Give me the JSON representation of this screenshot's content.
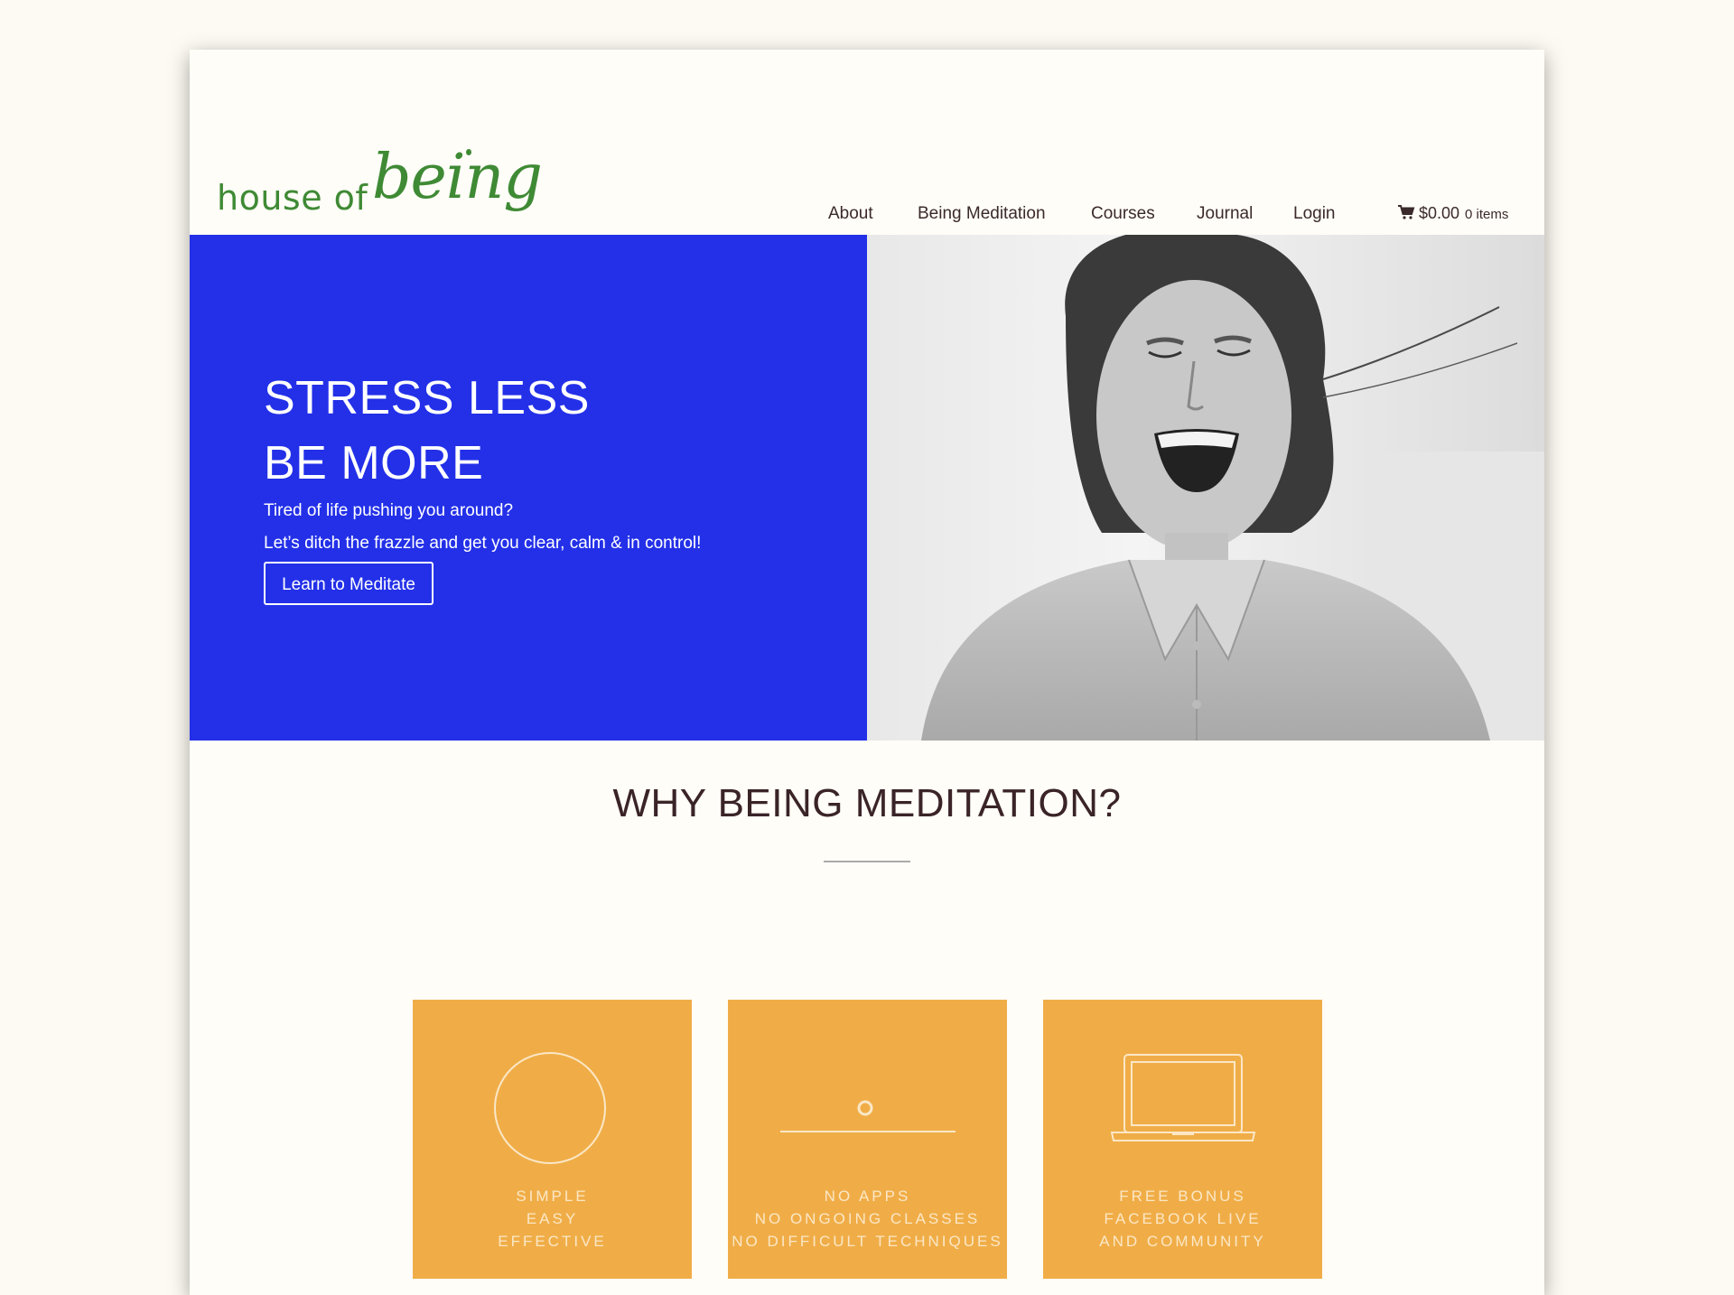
{
  "brand": {
    "name_part1": "house of",
    "name_part2": "being",
    "color": "#3f8a35"
  },
  "nav": {
    "items": [
      {
        "label": "About"
      },
      {
        "label": "Being Meditation"
      },
      {
        "label": "Courses"
      },
      {
        "label": "Journal"
      },
      {
        "label": "Login"
      }
    ],
    "cart": {
      "icon": "cart-icon",
      "total": "$0.00",
      "items": "0 items"
    }
  },
  "hero": {
    "title_line1": "STRESS LESS",
    "title_line2": "BE MORE",
    "subtitle1": "Tired of life pushing you around?",
    "subtitle2": "Let’s ditch the frazzle and get you clear, calm & in control!",
    "cta_label": "Learn to Meditate",
    "bg_color": "#2330e8"
  },
  "why": {
    "title": "WHY BEING MEDITATION?",
    "cards": [
      {
        "icon": "circle-icon",
        "lines": [
          "SIMPLE",
          "EASY",
          "EFFECTIVE"
        ]
      },
      {
        "icon": "dot-line-icon",
        "lines": [
          "NO APPS",
          "NO ONGOING CLASSES",
          "NO DIFFICULT TECHNIQUES"
        ]
      },
      {
        "icon": "laptop-icon",
        "lines": [
          "FREE BONUS",
          "FACEBOOK LIVE",
          "AND COMMUNITY"
        ]
      }
    ],
    "card_color": "#f0ad47"
  }
}
